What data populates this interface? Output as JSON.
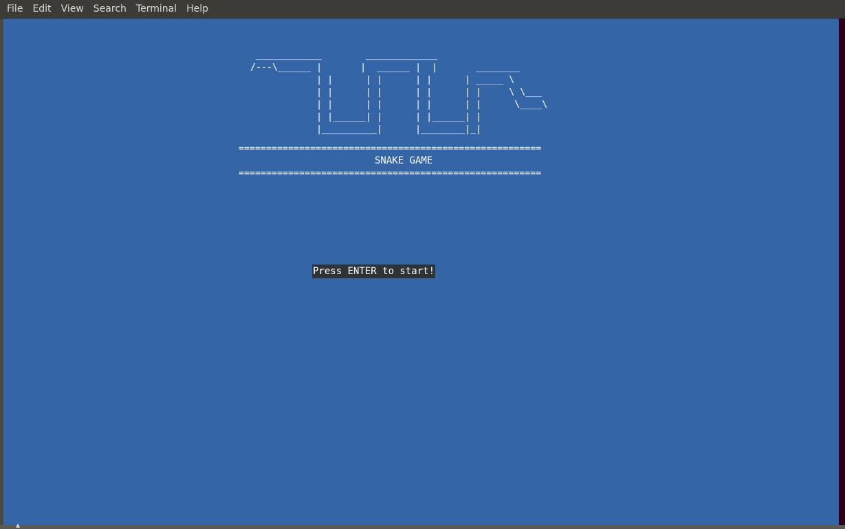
{
  "menubar": {
    "items": [
      {
        "label": "File"
      },
      {
        "label": "Edit"
      },
      {
        "label": "View"
      },
      {
        "label": "Search"
      },
      {
        "label": "Terminal"
      },
      {
        "label": "Help"
      }
    ]
  },
  "terminal": {
    "background_color": "#3465a6",
    "text_color": "#ffffff",
    "ascii_logo": "   ____________        _____________\n  /---\\______ |       |  ______ |  |       ________\n              | |      | |      | |      | _____ \\\n              | |      | |      | |      | |     \\ \\___\n              | |      | |      | |      | |      \\____\\\n              | |______| |      | |______| |\n              |__________|      |________|_|",
    "rule_top": "=======================================================",
    "title": "SNAKE GAME",
    "rule_bottom": "=======================================================",
    "start_prompt": "Press ENTER to start!"
  }
}
